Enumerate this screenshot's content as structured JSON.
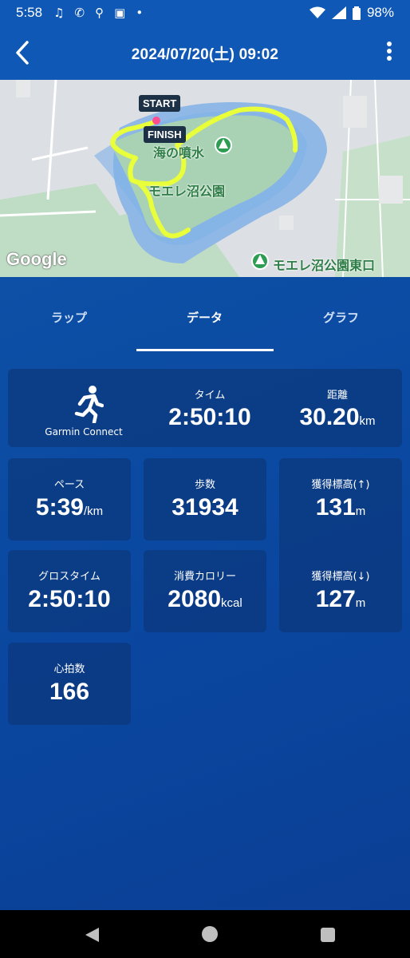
{
  "status_bar": {
    "time": "5:58",
    "battery": "98%"
  },
  "header": {
    "title": "2024/07/20(土) 09:02"
  },
  "map": {
    "start_label": "START",
    "finish_label": "FINISH",
    "poi_1": "海の噴水",
    "poi_2": "モエレ沼公園",
    "poi_3": "モエレ沼公園東口",
    "attribution": "Google"
  },
  "tabs": [
    {
      "label": "ラップ"
    },
    {
      "label": "データ"
    },
    {
      "label": "グラフ"
    }
  ],
  "source": {
    "label": "Garmin Connect"
  },
  "stats": {
    "time": {
      "label": "タイム",
      "value": "2:50:10"
    },
    "distance": {
      "label": "距離",
      "value": "30.20",
      "unit": "km"
    },
    "pace": {
      "label": "ペース",
      "value": "5:39",
      "unit": "/km"
    },
    "steps": {
      "label": "歩数",
      "value": "31934"
    },
    "ascent": {
      "label": "獲得標高(↑)",
      "value": "131",
      "unit": "m"
    },
    "gross_time": {
      "label": "グロスタイム",
      "value": "2:50:10"
    },
    "calories": {
      "label": "消費カロリー",
      "value": "2080",
      "unit": "kcal"
    },
    "descent": {
      "label": "獲得標高(↓)",
      "value": "127",
      "unit": "m"
    },
    "heart_rate": {
      "label": "心拍数",
      "value": "166"
    }
  },
  "colors": {
    "brand_blue": "#0f58b5",
    "card_bg": "#0d3578",
    "route": "#e8ff3a"
  }
}
